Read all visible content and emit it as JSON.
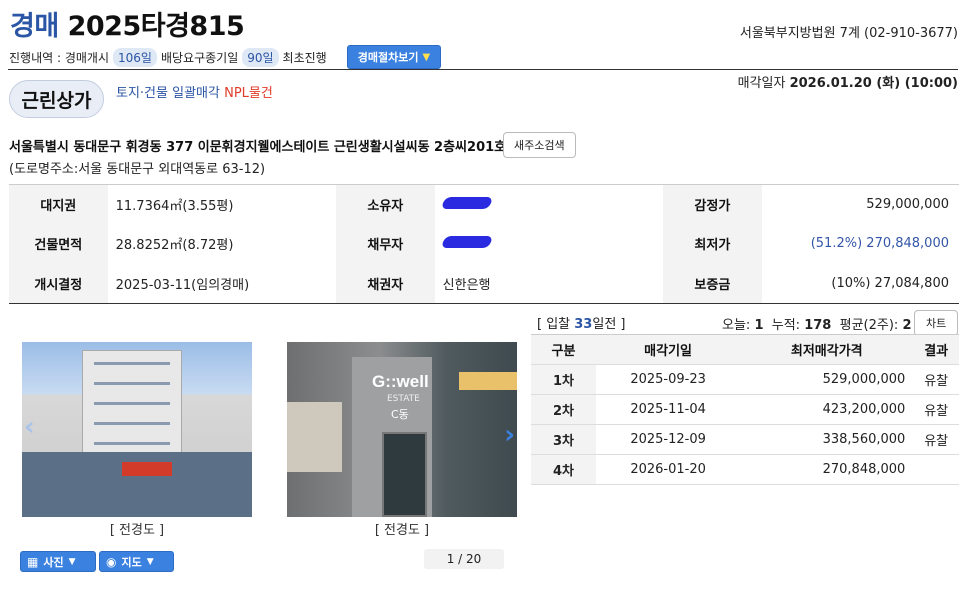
{
  "header": {
    "title_kw": "경매",
    "title_no": "2025타경815",
    "court": "서울북부지방법원 7계 (02-910-3677)"
  },
  "progress": {
    "label": "진행내역 : 경매개시",
    "days1": "106일",
    "label2": "배당요구종기일",
    "days2": "90일",
    "label3": "최초진행",
    "timeline_btn": "경매절차보기"
  },
  "property": {
    "type": "근린상가",
    "tags": "토지·건물 일괄매각",
    "npl": "NPL물건",
    "sale_date_label": "매각일자",
    "sale_date": "2026.01.20 (화) (10:00)",
    "address": "서울특별시 동대문구 휘경동 377 이문휘경지웰에스테이트 근린생활시설씨동 2층씨201호",
    "new_search_btn": "새주소검색",
    "road_address": "(도로명주소:서울 동대문구 외대역동로 63-12)"
  },
  "info": {
    "rows": [
      {
        "l1": "대지권",
        "v1": "11.7364㎡(3.55평)",
        "l2": "소유자",
        "l3": "감정가",
        "v3": "529,000,000"
      },
      {
        "l1": "건물면적",
        "v1": "28.8252㎡(8.72평)",
        "l2": "채무자",
        "l3": "최저가",
        "v3": "(51.2%) 270,848,000"
      },
      {
        "l1": "개시결정",
        "v1": "2025-03-11(임의경매)",
        "l2": "채권자",
        "v2": "신한은행",
        "l3": "보증금",
        "v3": "(10%) 27,084,800"
      }
    ]
  },
  "photos": {
    "caption1": "[ 전경도 ]",
    "caption2": "[ 전경도 ]",
    "photo_btn": "사진",
    "map_btn": "지도",
    "pager": "1 / 20",
    "sign_text": "G::well",
    "sign_sub": "ESTATE",
    "sign_dong": "C동"
  },
  "stats": {
    "bid_prefix": "[ 입찰",
    "bid_days": "33",
    "bid_suffix": "일전 ]",
    "today_label": "오늘:",
    "today": "1",
    "total_label": "누적:",
    "total": "178",
    "avg_label": "평균(2주):",
    "avg": "2",
    "chart_btn": "차트"
  },
  "rounds": {
    "headers": [
      "구분",
      "매각기일",
      "최저매각가격",
      "결과"
    ],
    "rows": [
      {
        "round": "1차",
        "date": "2025-09-23",
        "price": "529,000,000",
        "result": "유찰"
      },
      {
        "round": "2차",
        "date": "2025-11-04",
        "price": "423,200,000",
        "result": "유찰"
      },
      {
        "round": "3차",
        "date": "2025-12-09",
        "price": "338,560,000",
        "result": "유찰"
      },
      {
        "round": "4차",
        "date": "2026-01-20",
        "price": "270,848,000",
        "result": ""
      }
    ]
  }
}
